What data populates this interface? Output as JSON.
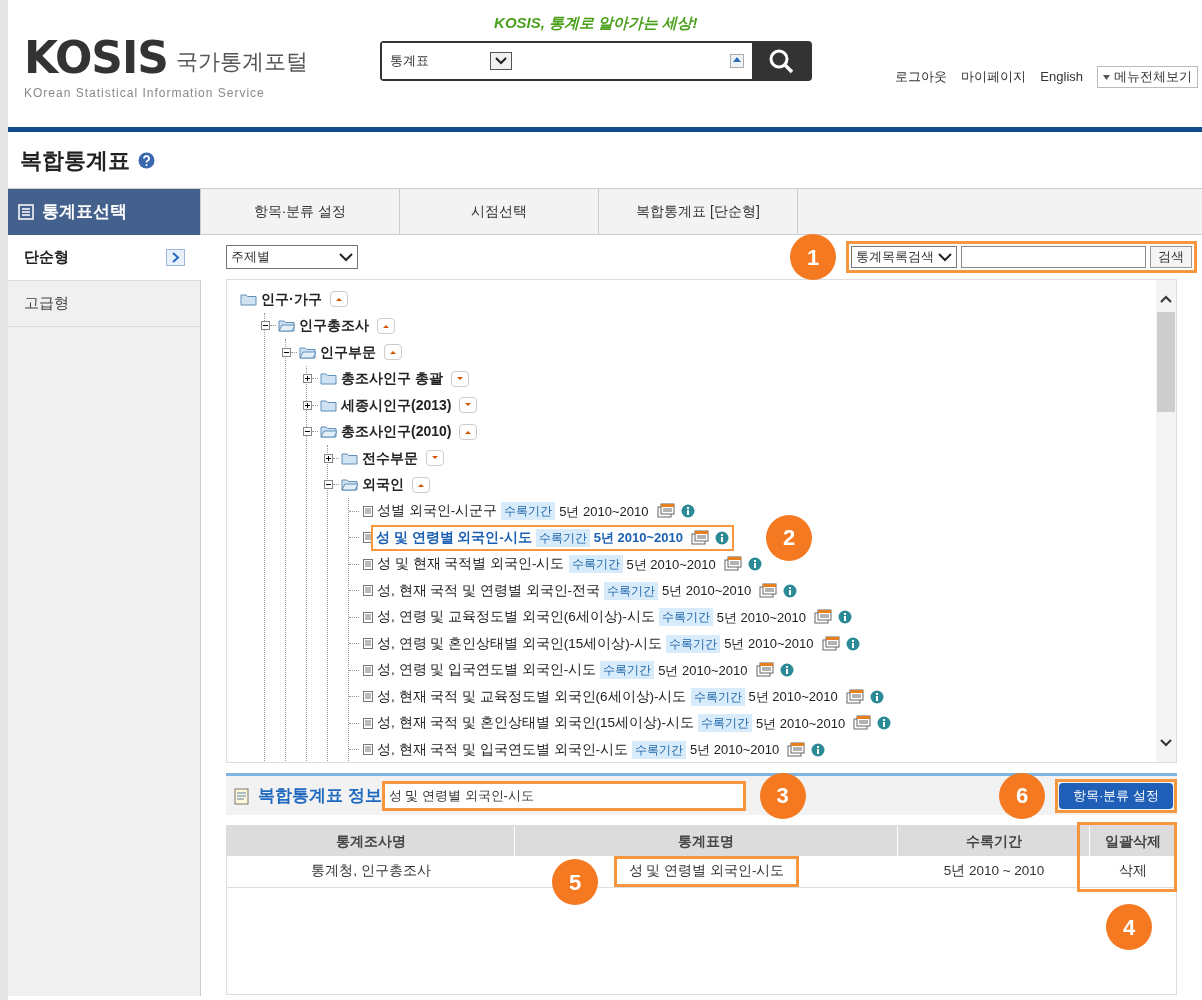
{
  "header": {
    "logo": "KOSIS",
    "logo_ko": "국가통계포털",
    "logo_sub": "KOrean Statistical Information Service",
    "slogan": "KOSIS, 통계로 알아가는 세상!",
    "search_scope": "통계표",
    "links": [
      "로그아웃",
      "마이페이지",
      "English"
    ],
    "menu_button": "메뉴전체보기"
  },
  "page_title": "복합통계표",
  "sidebar": {
    "title": "통계표선택",
    "items": [
      {
        "label": "단순형",
        "selected": true
      },
      {
        "label": "고급형",
        "selected": false
      }
    ]
  },
  "tabs": [
    {
      "label": "항목·분류 설정",
      "selected": false
    },
    {
      "label": "시점선택",
      "selected": false
    },
    {
      "label": "복합통계표 [단순형]",
      "selected": false
    }
  ],
  "filter": {
    "value": "주제별"
  },
  "list_search": {
    "scope": "통계목록검색",
    "button": "검색",
    "callout": "1"
  },
  "tree": [
    {
      "label": "인구·가구",
      "expanded": true,
      "children": [
        {
          "label": "인구총조사",
          "expanded": true,
          "children": [
            {
              "label": "인구부문",
              "expanded": true,
              "children": [
                {
                  "label": "총조사인구 총괄",
                  "expanded": false
                },
                {
                  "label": "세종시인구(2013)",
                  "expanded": false
                },
                {
                  "label": "총조사인구(2010)",
                  "expanded": true,
                  "children": [
                    {
                      "label": "전수부문",
                      "expanded": false
                    },
                    {
                      "label": "외국인",
                      "expanded": true,
                      "tables": [
                        {
                          "label": "성별 외국인-시군구",
                          "tag": "수록기간",
                          "period": "5년 2010~2010",
                          "selected": false
                        },
                        {
                          "label": "성 및 연령별 외국인-시도",
                          "tag": "수록기간",
                          "period": "5년 2010~2010",
                          "selected": true,
                          "callout": "2"
                        },
                        {
                          "label": "성 및 현재 국적별 외국인-시도",
                          "tag": "수록기간",
                          "period": "5년 2010~2010",
                          "selected": false
                        },
                        {
                          "label": "성, 현재 국적 및 연령별 외국인-전국",
                          "tag": "수록기간",
                          "period": "5년 2010~2010",
                          "selected": false
                        },
                        {
                          "label": "성, 연령 및 교육정도별 외국인(6세이상)-시도",
                          "tag": "수록기간",
                          "period": "5년 2010~2010",
                          "selected": false
                        },
                        {
                          "label": "성, 연령 및 혼인상태별 외국인(15세이상)-시도",
                          "tag": "수록기간",
                          "period": "5년 2010~2010",
                          "selected": false
                        },
                        {
                          "label": "성, 연령 및 입국연도별 외국인-시도",
                          "tag": "수록기간",
                          "period": "5년 2010~2010",
                          "selected": false
                        },
                        {
                          "label": "성, 현재 국적 및 교육정도별 외국인(6세이상)-시도",
                          "tag": "수록기간",
                          "period": "5년 2010~2010",
                          "selected": false
                        },
                        {
                          "label": "성, 현재 국적 및 혼인상태별 외국인(15세이상)-시도",
                          "tag": "수록기간",
                          "period": "5년 2010~2010",
                          "selected": false
                        },
                        {
                          "label": "성, 현재 국적 및 입국연도별 외국인-시도",
                          "tag": "수록기간",
                          "period": "5년 2010~2010",
                          "selected": false
                        }
                      ]
                    }
                  ]
                }
              ]
            }
          ]
        }
      ]
    }
  ],
  "info": {
    "title": "복합통계표 정보",
    "value": "성 및 연령별 외국인-시도",
    "callout": "3",
    "button": "항목·분류 설정",
    "button_callout": "6"
  },
  "table": {
    "columns": [
      "통계조사명",
      "통계표명",
      "수록기간",
      "일괄삭제"
    ],
    "rows": [
      [
        "통계청, 인구총조사",
        "성 및 연령별 외국인-시도",
        "5년 2010 ~ 2010",
        "삭제"
      ]
    ],
    "name_callout": "5",
    "delete_callout": "4"
  }
}
